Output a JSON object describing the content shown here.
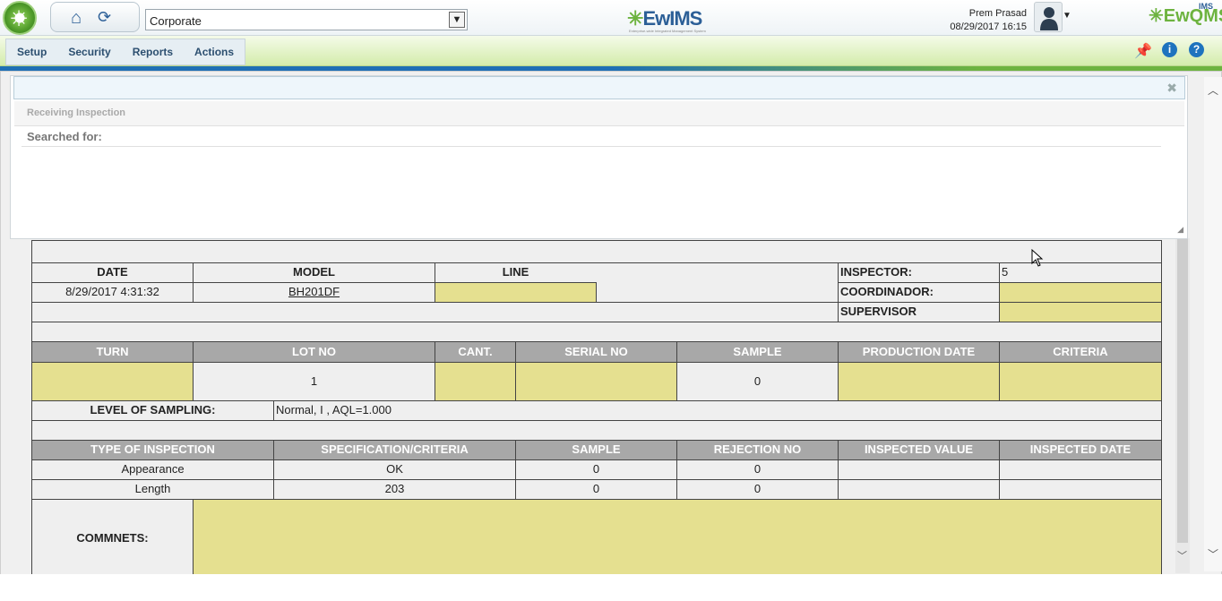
{
  "header": {
    "company": "Corporate",
    "brand_center": "EwIMS",
    "brand_center_tag": "Enterprise-wide Integrated Management System",
    "brand_right": "EwQMS",
    "brand_right_sup": "IMS",
    "user_name": "Prem Prasad",
    "datetime": "08/29/2017 16:15"
  },
  "menu": [
    "Setup",
    "Security",
    "Reports",
    "Actions"
  ],
  "panel": {
    "breadcrumb": "Receiving Inspection",
    "searched_for": "Searched for:"
  },
  "form": {
    "h1": {
      "date": "DATE",
      "model": "MODEL",
      "line": "LINE",
      "inspector": "INSPECTOR:",
      "inspector_val": "5"
    },
    "r1": {
      "date": "8/29/2017 4:31:32",
      "model": "BH201DF",
      "line": "",
      "coordinador": "COORDINADOR:",
      "coordinador_val": ""
    },
    "supervisor": "SUPERVISOR",
    "supervisor_val": "",
    "h2": [
      "TURN",
      "LOT NO",
      "CANT.",
      "SERIAL NO",
      "SAMPLE",
      "PRODUCTION DATE",
      "CRITERIA"
    ],
    "r2": [
      "",
      "1",
      "",
      "",
      "0",
      "",
      ""
    ],
    "level_label": "LEVEL OF SAMPLING:",
    "level_val": "Normal, I , AQL=1.000",
    "h3": [
      "TYPE OF INSPECTION",
      "SPECIFICATION/CRITERIA",
      "SAMPLE",
      "REJECTION NO",
      "INSPECTED VALUE",
      "INSPECTED DATE"
    ],
    "rows": [
      [
        "Appearance",
        "OK",
        "0",
        "0",
        "",
        ""
      ],
      [
        "Length",
        "203",
        "0",
        "0",
        "",
        ""
      ]
    ],
    "comments": "COMMNETS:"
  }
}
